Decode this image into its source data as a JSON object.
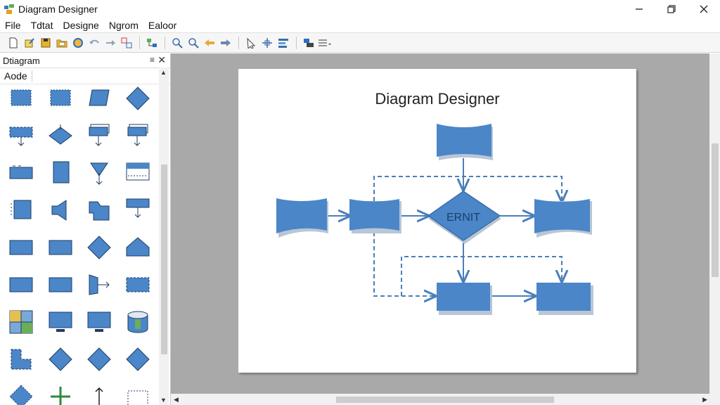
{
  "window": {
    "title": "Diagram Designer",
    "controls": [
      "minimize-icon",
      "maximize-icon",
      "close-icon"
    ]
  },
  "menu": [
    "File",
    "Tdtat",
    "Designe",
    "Ngrom",
    "Ealoor"
  ],
  "toolbar": {
    "icons": [
      "new-document-icon",
      "edit-icon",
      "save-icon",
      "open-folder-icon",
      "color-fill-icon",
      "undo-icon",
      "redo-icon",
      "group-icon",
      "separator",
      "connector-icon",
      "separator",
      "zoom-in-icon",
      "zoom-out-icon",
      "arrow-left-icon",
      "arrow-right-icon",
      "separator",
      "pointer-icon",
      "move-icon",
      "align-icon",
      "separator",
      "layers-icon",
      "line-style-icon"
    ]
  },
  "panel": {
    "title": "Dtiagram",
    "pin_glyph": "≡",
    "close_glyph": "✕",
    "sub_label": "Aode"
  },
  "palette": {
    "shape_icons": [
      "rectangle-dashed-icon",
      "rectangle-dashed-icon",
      "parallelogram-icon",
      "diamond-icon",
      "process-arrow-icon",
      "decision-arrow-icon",
      "stacked-process-icon",
      "stacked-process-icon",
      "rectangle-bar-icon",
      "tall-rectangle-icon",
      "merge-arrow-icon",
      "lined-rectangle-icon",
      "dotted-rectangle-icon",
      "speaker-shape-icon",
      "flag-shape-icon",
      "rectangle-down-arrow-icon",
      "wide-rectangle-icon",
      "wide-rectangle-icon",
      "diamond-icon",
      "house-shape-icon",
      "wide-rectangle-icon",
      "wide-rectangle-icon",
      "arrow-right-shape-icon",
      "dotted-frame-icon",
      "grid-table-icon",
      "monitor-icon",
      "monitor-icon",
      "cylinder-icon",
      "l-shape-icon",
      "diamond-icon",
      "diamond-icon",
      "diamond-icon",
      "diamond-dashed-icon",
      "plus-icon",
      "up-arrow-icon",
      "dotted-box-icon"
    ]
  },
  "diagram": {
    "title": "Diagram Designer",
    "decision_label": "ERNIT",
    "shape_color": "#4a86c8",
    "line_color": "#4a7fb9"
  },
  "colors": {
    "workspace": "#a9a9a9",
    "accent": "#4a86c8"
  }
}
